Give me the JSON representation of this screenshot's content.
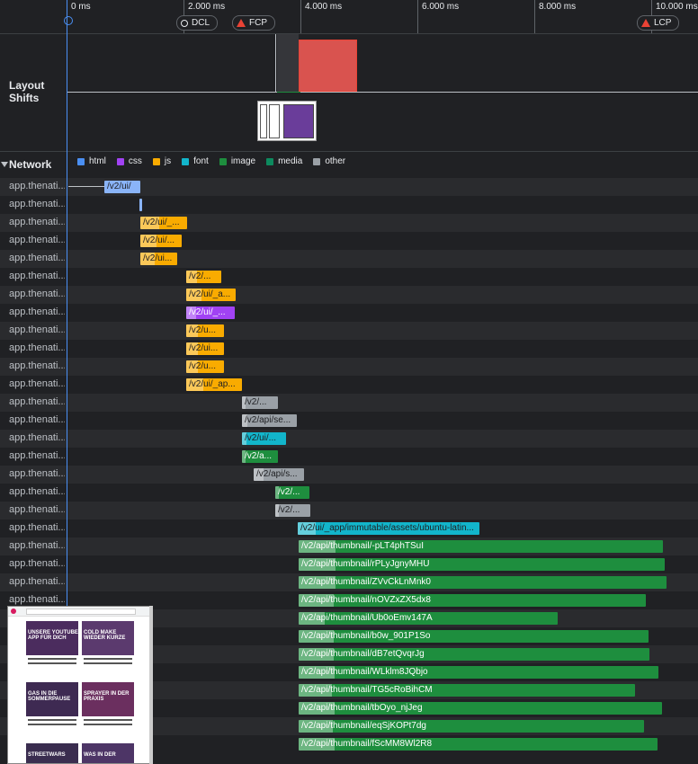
{
  "ruler": {
    "ticks": [
      "0 ms",
      "2.000 ms",
      "4.000 ms",
      "6.000 ms",
      "8.000 ms",
      "10.000 ms"
    ],
    "markers": {
      "dcl": "DCL",
      "fcp": "FCP",
      "lcp": "LCP"
    }
  },
  "layout_shifts": {
    "label": "Layout Shifts"
  },
  "network": {
    "title": "Network",
    "legend": [
      {
        "label": "html",
        "color": "#4a8ff3"
      },
      {
        "label": "css",
        "color": "#a142f4"
      },
      {
        "label": "js",
        "color": "#f9ab00"
      },
      {
        "label": "font",
        "color": "#12b5cb"
      },
      {
        "label": "image",
        "color": "#1e8e3e"
      },
      {
        "label": "media",
        "color": "#0d8a5e"
      },
      {
        "label": "other",
        "color": "#9aa0a6"
      }
    ],
    "rows": [
      {
        "host": "app.thenati...",
        "label": "/v2/ui/",
        "type": "html"
      },
      {
        "host": "app.thenati...",
        "label": "",
        "type": "html"
      },
      {
        "host": "app.thenati...",
        "label": "/v2/ui/_...",
        "type": "js"
      },
      {
        "host": "app.thenati...",
        "label": "/v2/ui/...",
        "type": "js"
      },
      {
        "host": "app.thenati...",
        "label": "/v2/ui...",
        "type": "js"
      },
      {
        "host": "app.thenati...",
        "label": "/v2/...",
        "type": "js"
      },
      {
        "host": "app.thenati...",
        "label": "/v2/ui/_a...",
        "type": "js"
      },
      {
        "host": "app.thenati...",
        "label": "/v2/ui/_...",
        "type": "css"
      },
      {
        "host": "app.thenati...",
        "label": "/v2/u...",
        "type": "js"
      },
      {
        "host": "app.thenati...",
        "label": "/v2/ui...",
        "type": "js"
      },
      {
        "host": "app.thenati...",
        "label": "/v2/u...",
        "type": "js"
      },
      {
        "host": "app.thenati...",
        "label": "/v2/ui/_ap...",
        "type": "js"
      },
      {
        "host": "app.thenati...",
        "label": "/v2/...",
        "type": "other"
      },
      {
        "host": "app.thenati...",
        "label": "/v2/api/se...",
        "type": "other"
      },
      {
        "host": "app.thenati...",
        "label": "/v2/ui/...",
        "type": "font"
      },
      {
        "host": "app.thenati...",
        "label": "/v2/a...",
        "type": "image"
      },
      {
        "host": "app.thenati...",
        "label": "/v2/api/s...",
        "type": "other"
      },
      {
        "host": "app.thenati...",
        "label": "/v2/...",
        "type": "image"
      },
      {
        "host": "app.thenati...",
        "label": "/v2/...",
        "type": "other"
      },
      {
        "host": "app.thenati...",
        "label": "/v2/ui/_app/immutable/assets/ubuntu-latin...",
        "type": "font"
      },
      {
        "host": "app.thenati...",
        "label": "/v2/api/thumbnail/-pLT4phTSuI",
        "type": "image"
      },
      {
        "host": "app.thenati...",
        "label": "/v2/api/thumbnail/rPLyJgnyMHU",
        "type": "image"
      },
      {
        "host": "app.thenati...",
        "label": "/v2/api/thumbnail/ZVvCkLnMnk0",
        "type": "image"
      },
      {
        "host": "app.thenati...",
        "label": "/v2/api/thumbnail/nOVZxZX5dx8",
        "type": "image"
      },
      {
        "host": "",
        "label": "/v2/api/thumbnail/Ub0oEmv147A",
        "type": "image"
      },
      {
        "host": "",
        "label": "/v2/api/thumbnail/b0w_901P1So",
        "type": "image"
      },
      {
        "host": "",
        "label": "/v2/api/thumbnail/dB7etQvqrJg",
        "type": "image"
      },
      {
        "host": "",
        "label": "/v2/api/thumbnail/WLklm8JQbjo",
        "type": "image"
      },
      {
        "host": "",
        "label": "/v2/api/thumbnail/TG5cRoBihCM",
        "type": "image"
      },
      {
        "host": "",
        "label": "/v2/api/thumbnail/tbOyo_njJeg",
        "type": "image"
      },
      {
        "host": "",
        "label": "/v2/api/thumbnail/eqSjKOPt7dg",
        "type": "image"
      },
      {
        "host": "",
        "label": "/v2/api/thumbnail/fScMM8Wl2R8",
        "type": "image"
      }
    ]
  },
  "screenshot_preview": {
    "cards": [
      "UNSERE YOUTUBE APP FÜR DICH",
      "COLD MAKE WIEDER KURZE",
      "GAS IN DIE SOMMERPAUSE",
      "SPRAYER IN DER PRAXIS",
      "STREETWARS",
      "WAS IN DER"
    ]
  }
}
